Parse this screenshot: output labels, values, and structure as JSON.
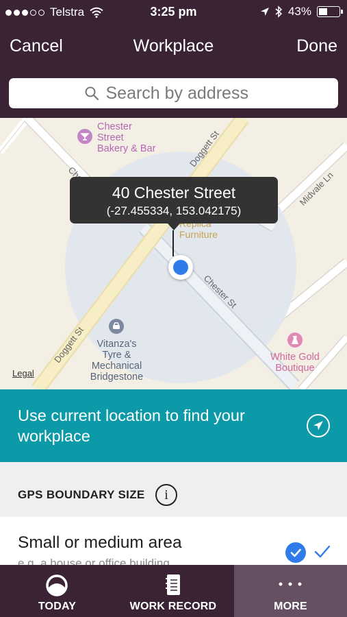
{
  "status_bar": {
    "carrier": "Telstra",
    "time": "3:25 pm",
    "battery_percent_text": "43%",
    "battery_level": 0.43,
    "signal_bars": 3,
    "signal_total": 5
  },
  "nav": {
    "cancel_label": "Cancel",
    "title": "Workplace",
    "done_label": "Done"
  },
  "search": {
    "placeholder": "Search by address"
  },
  "map": {
    "callout_address": "40 Chester Street",
    "callout_coords": "(-27.455334, 153.042175)",
    "pois": [
      {
        "name_lines": [
          "Chester",
          "Street",
          "Bakery & Bar"
        ],
        "icon": "cocktail-icon",
        "color": "#b268b4"
      },
      {
        "name_lines": [
          "Replica",
          "Furniture"
        ],
        "icon": "shopping-icon",
        "color": "#c9a14e"
      },
      {
        "name_lines": [
          "Vitanza's",
          "Tyre &",
          "Mechanical",
          "Bridgestone"
        ],
        "icon": "car-icon",
        "color": "#5e6f86"
      },
      {
        "name_lines": [
          "White Gold",
          "Boutique"
        ],
        "icon": "clothing-icon",
        "color": "#d0679e"
      }
    ],
    "streets": [
      "Chester St",
      "Doggett St",
      "Doggett St",
      "Chester St",
      "Midvale Ln"
    ],
    "legal_label": "Legal"
  },
  "location_banner": {
    "text": "Use current location to find your workplace",
    "icon": "location-arrow-icon"
  },
  "gps_section": {
    "title": "GPS BOUNDARY SIZE",
    "info_label": "i",
    "option_title": "Small or medium area",
    "option_subtitle": "e.g. a house or office building",
    "option_selected": true
  },
  "tabs": [
    {
      "label": "TODAY",
      "icon": "clock-ring-icon",
      "active": false
    },
    {
      "label": "WORK RECORD",
      "icon": "notebook-icon",
      "active": false
    },
    {
      "label": "MORE",
      "icon": "more-dots-icon",
      "active": true
    }
  ],
  "colors": {
    "header_bg": "#3b2336",
    "banner_bg": "#0d9aa8",
    "pin_blue": "#2f7bea",
    "tab_active_bg": "#654f62"
  }
}
